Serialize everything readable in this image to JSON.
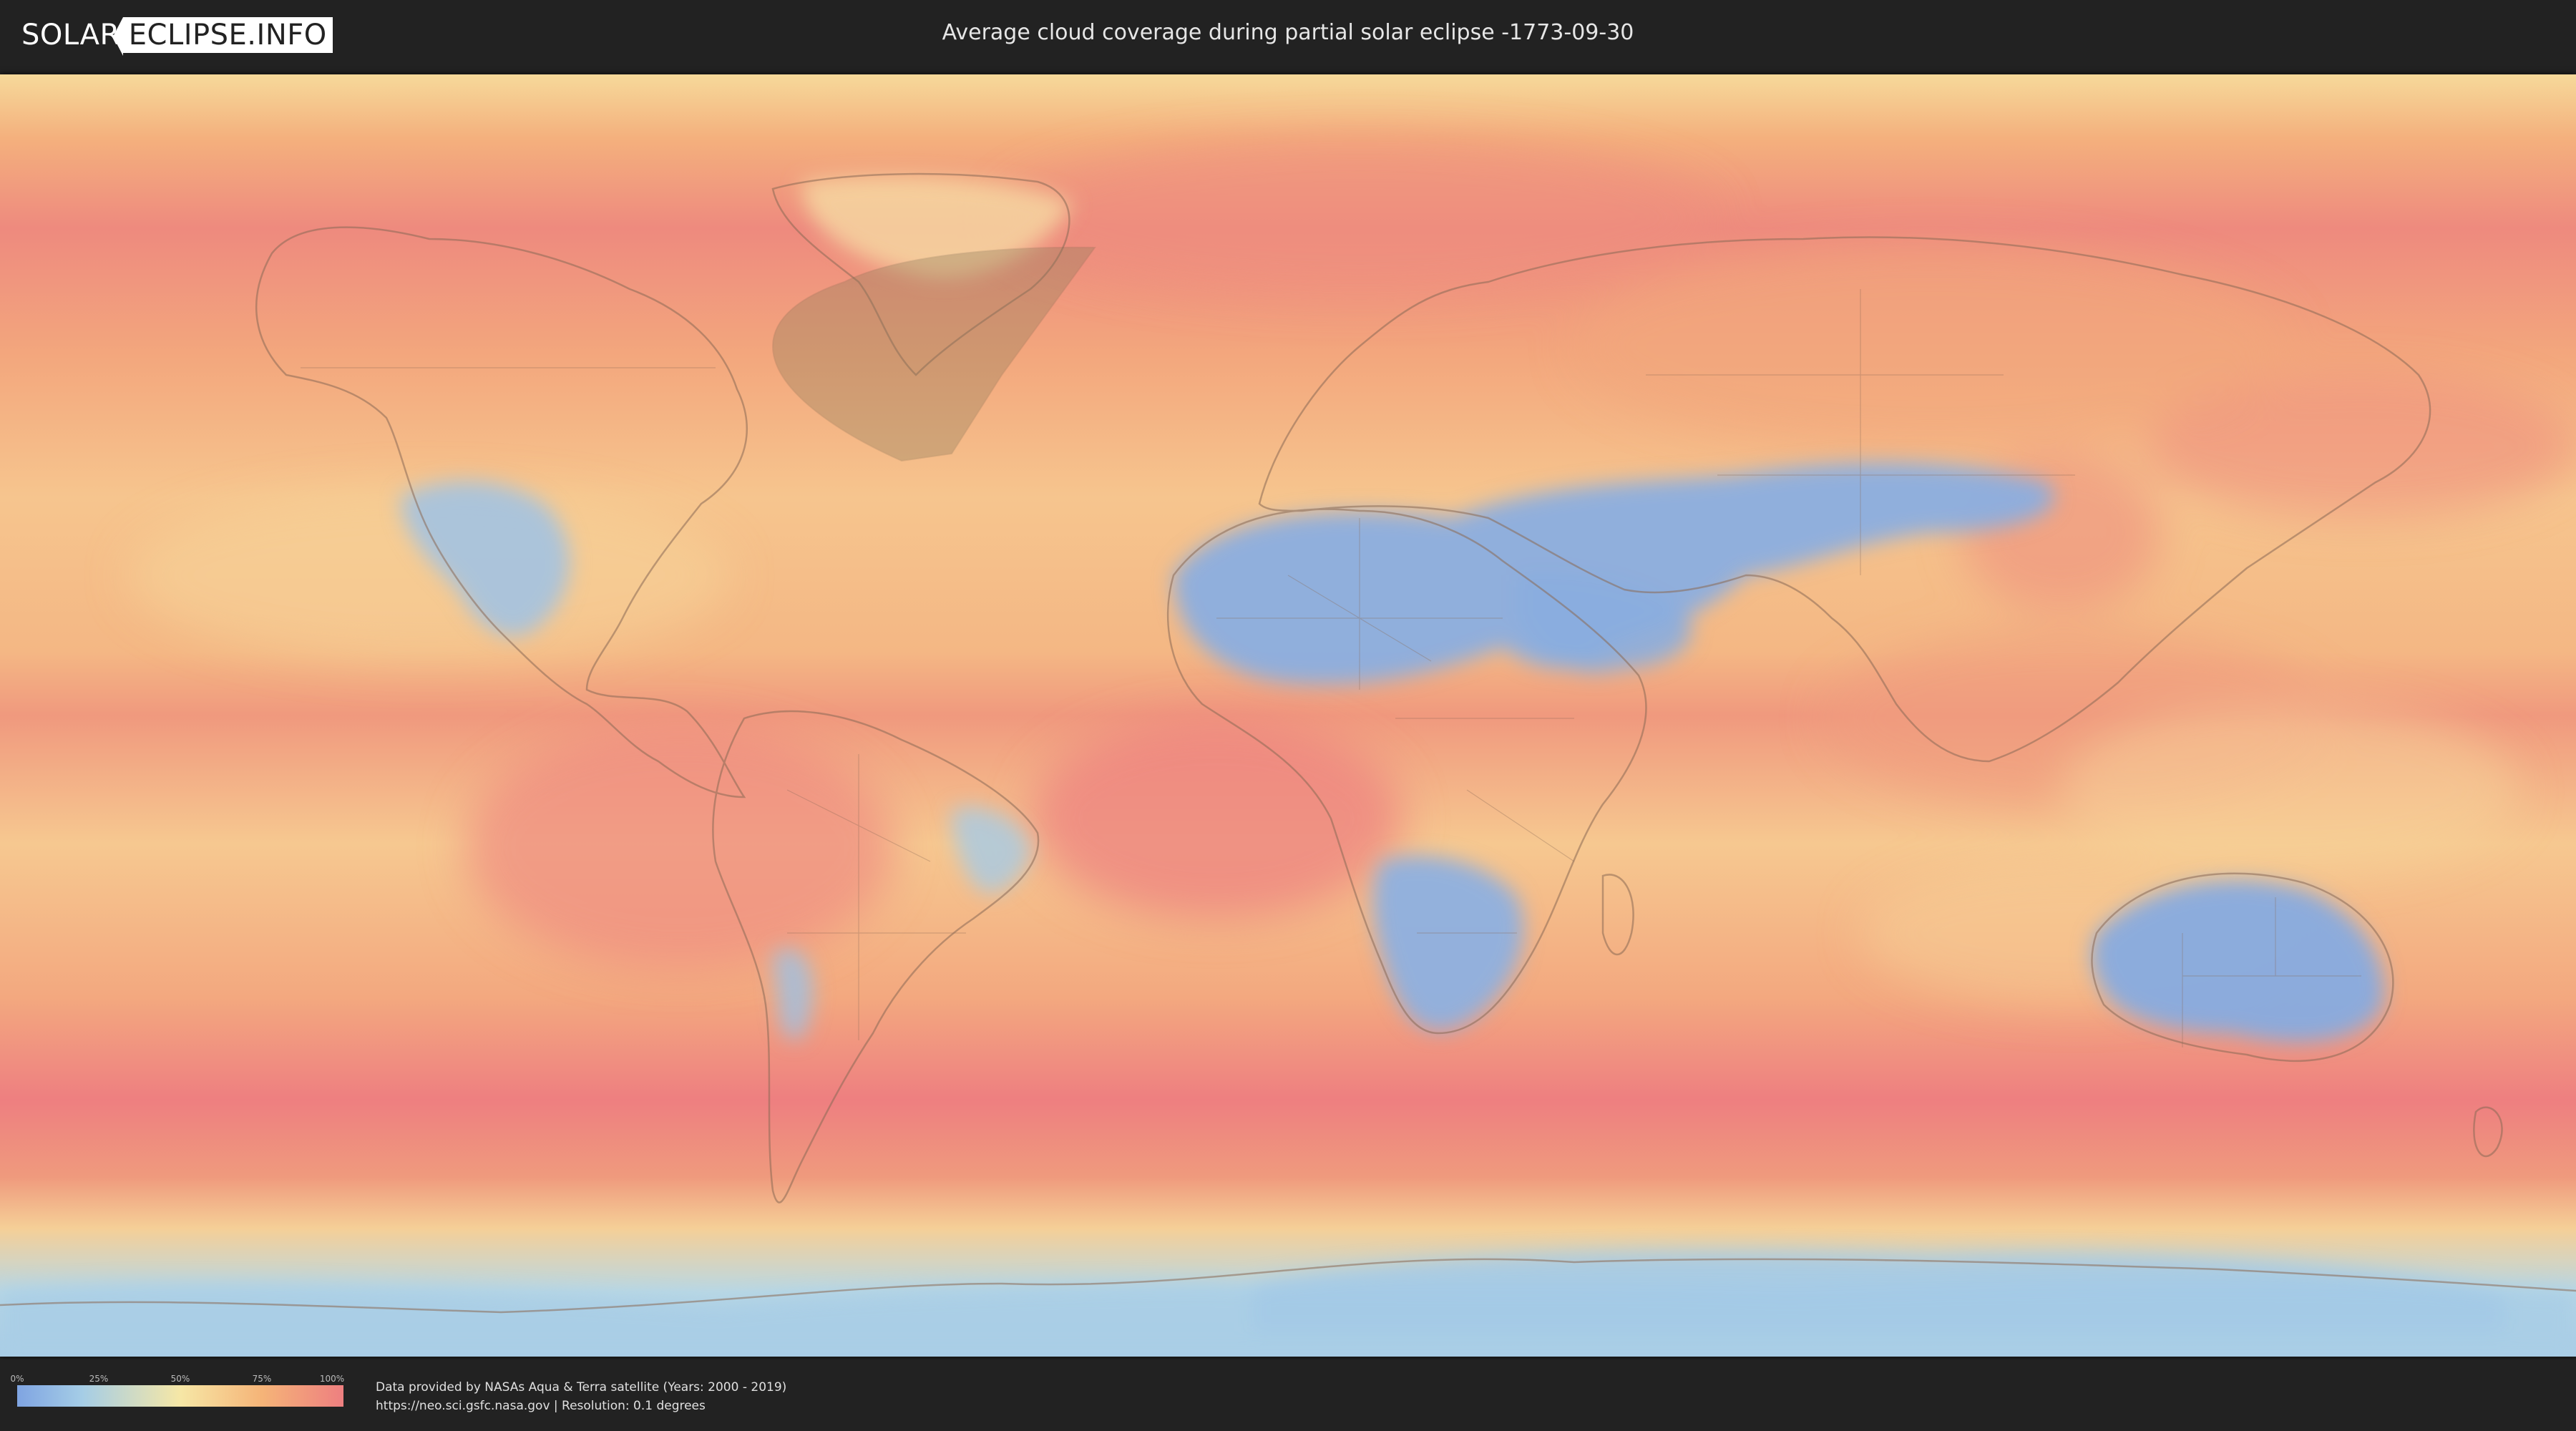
{
  "header": {
    "logo_part1": "SOLAR",
    "logo_part2": "ECLIPSE.INFO",
    "title": "Average cloud coverage during partial solar eclipse -1773-09-30"
  },
  "map": {
    "projection": "equirectangular",
    "overlay": "cloud coverage",
    "eclipse_region": "partial eclipse visibility area over northern Canada and Greenland",
    "colors": {
      "clear": "#7fa4e2",
      "low": "#a5cde6",
      "mid": "#f6e7a6",
      "high": "#f5b478",
      "full": "#ee7f80"
    }
  },
  "legend": {
    "ticks": [
      "0%",
      "25%",
      "50%",
      "75%",
      "100%"
    ]
  },
  "footer": {
    "credit_line1": "Data provided by NASAs Aqua & Terra satellite (Years: 2000 - 2019)",
    "credit_line2": "https://neo.sci.gsfc.nasa.gov | Resolution: 0.1 degrees"
  }
}
